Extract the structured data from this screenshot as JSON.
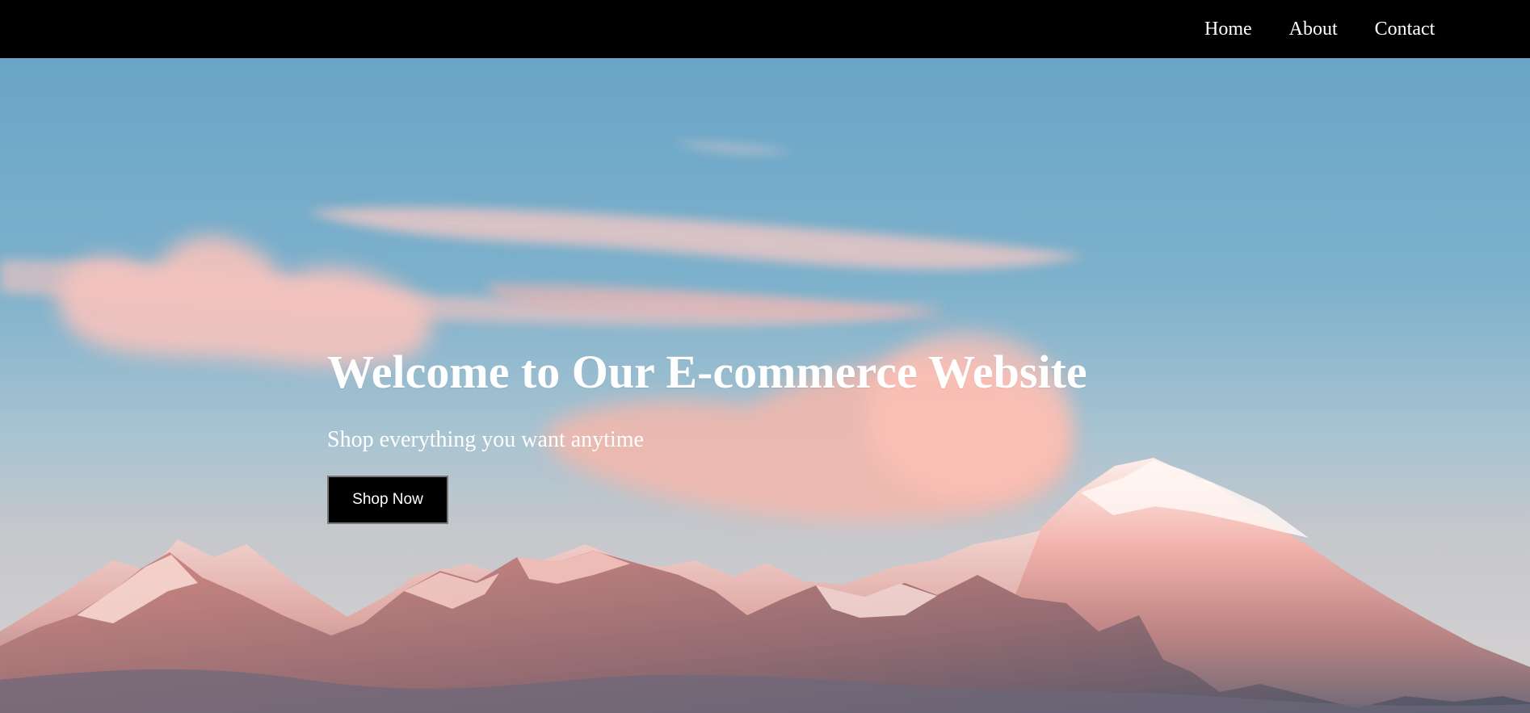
{
  "navigation": {
    "items": [
      {
        "label": "Home"
      },
      {
        "label": "About"
      },
      {
        "label": "Contact"
      }
    ]
  },
  "hero": {
    "title": "Welcome to Our E-commerce Website",
    "subtitle": "Shop everything you want anytime",
    "button_label": "Shop Now"
  }
}
